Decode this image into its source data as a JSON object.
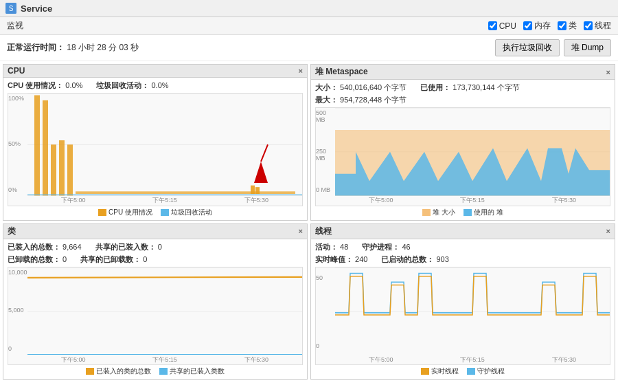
{
  "titleBar": {
    "icon": "service-icon",
    "title": "Service"
  },
  "toolbar": {
    "label": "监视",
    "checkboxes": [
      {
        "id": "cb-cpu",
        "label": "CPU",
        "checked": true
      },
      {
        "id": "cb-memory",
        "label": "内存",
        "checked": true
      },
      {
        "id": "cb-class",
        "label": "类",
        "checked": true
      },
      {
        "id": "cb-thread",
        "label": "线程",
        "checked": true
      }
    ]
  },
  "uptime": {
    "label": "正常运行时间：",
    "value": "18 小时 28 分 03 秒"
  },
  "buttons": {
    "gc": "执行垃圾回收",
    "heap_dump": "堆 Dump"
  },
  "panels": {
    "cpu": {
      "title": "CPU",
      "close": "×",
      "stats": [
        {
          "label": "CPU 使用情况：",
          "value": "0.0%"
        },
        {
          "label": "垃圾回收活动：",
          "value": "0.0%"
        }
      ],
      "y_labels": [
        "100%",
        "50%",
        "0%"
      ],
      "x_labels": [
        "下午5:00",
        "下午5:15",
        "下午5:30"
      ],
      "legend": [
        {
          "color": "#e8a020",
          "label": "CPU 使用情况"
        },
        {
          "color": "#5bb8e8",
          "label": "垃圾回收活动"
        }
      ]
    },
    "heap": {
      "title": "堆  Metaspace",
      "close": "×",
      "stats": [
        {
          "label": "大小：",
          "value": "540,016,640 个字节"
        },
        {
          "label": "已使用：",
          "value": "173,730,144 个字节"
        },
        {
          "label": "最大：",
          "value": "954,728,448 个字节"
        }
      ],
      "y_labels": [
        "500 MB",
        "250 MB",
        "0 MB"
      ],
      "x_labels": [
        "下午5:00",
        "下午5:15",
        "下午5:30"
      ],
      "legend": [
        {
          "color": "#f5c07a",
          "label": "堆 大小"
        },
        {
          "color": "#5bb8e8",
          "label": "使用的 堆"
        }
      ]
    },
    "class": {
      "title": "类",
      "close": "×",
      "stats": [
        {
          "label": "已装入的总数：",
          "value": "9,664"
        },
        {
          "label": "共享的已装入数：",
          "value": "0"
        },
        {
          "label": "已卸载的总数：",
          "value": "0"
        },
        {
          "label": "共享的已卸载数：",
          "value": "0"
        }
      ],
      "y_labels": [
        "10,000",
        "5,000",
        "0"
      ],
      "x_labels": [
        "下午5:00",
        "下午5:15",
        "下午5:30"
      ],
      "legend": [
        {
          "color": "#e8a020",
          "label": "已装入的类的总数"
        },
        {
          "color": "#5bb8e8",
          "label": "共享的已装入类数"
        }
      ]
    },
    "thread": {
      "title": "线程",
      "close": "×",
      "stats": [
        {
          "label": "活动：",
          "value": "48"
        },
        {
          "label": "守护进程：",
          "value": "46"
        },
        {
          "label": "实时峰值：",
          "value": "240"
        },
        {
          "label": "已启动的总数：",
          "value": "903"
        }
      ],
      "y_labels": [
        "50",
        "0"
      ],
      "x_labels": [
        "下午5:00",
        "下午5:15",
        "下午5:30"
      ],
      "legend": [
        {
          "color": "#e8a020",
          "label": "实时线程"
        },
        {
          "color": "#5bb8e8",
          "label": "守护线程"
        }
      ]
    }
  }
}
